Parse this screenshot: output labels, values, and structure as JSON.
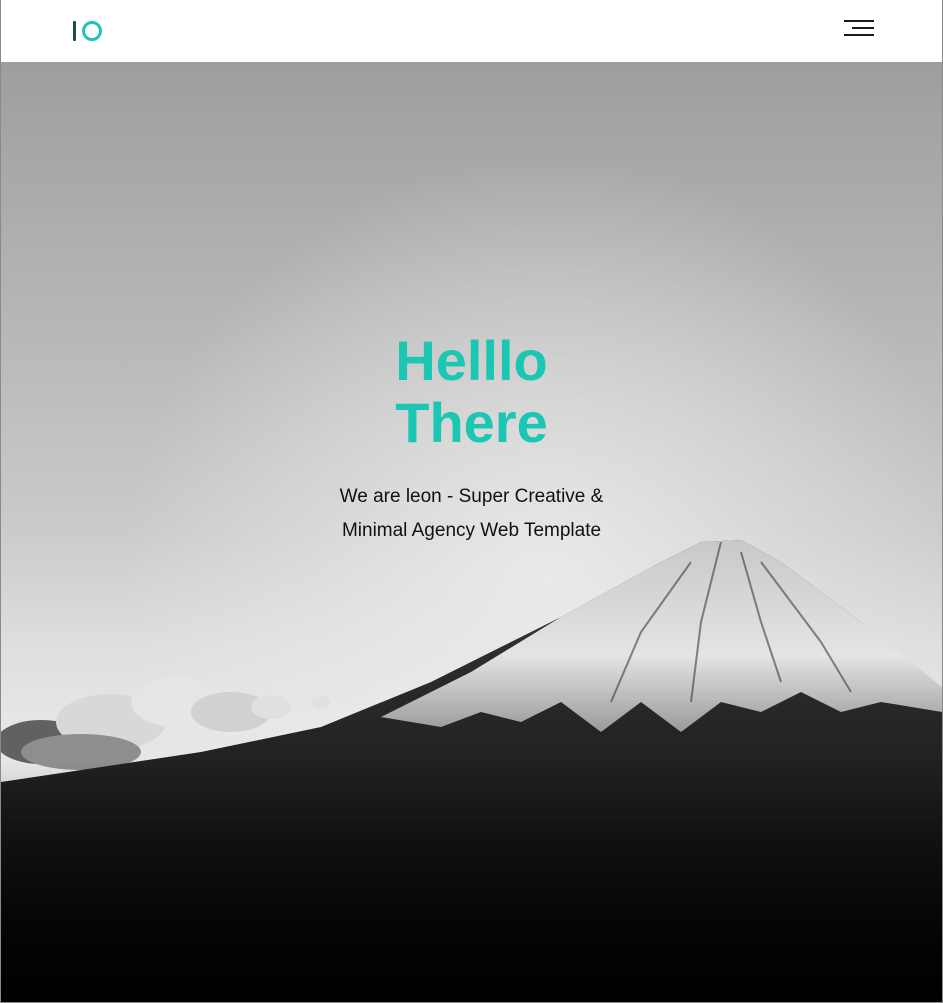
{
  "header": {
    "logo_text": "IO",
    "menu_icon": "hamburger-menu-icon"
  },
  "hero": {
    "headline_line1": "Helllo",
    "headline_line2": "There",
    "subtitle_line1": "We are leon - Super Creative &",
    "subtitle_line2": "Minimal Agency Web Template",
    "background_image": "snow-capped-mountain-grayscale"
  },
  "colors": {
    "accent": "#1bc6b3",
    "logo_dark": "#1d4a4a",
    "text_dark": "#111111",
    "header_bg": "#ffffff"
  }
}
